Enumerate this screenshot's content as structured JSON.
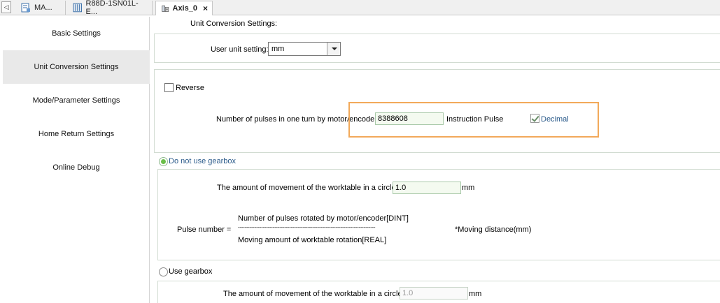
{
  "tabs": [
    {
      "label": "MA...",
      "icon": "program-icon"
    },
    {
      "label": "R88D-1SN01L-E...",
      "icon": "servo-drive-icon"
    },
    {
      "label": "Axis_0",
      "icon": "axis-icon",
      "active": true
    }
  ],
  "tab_close": "×",
  "tab_scroll": "◁",
  "sidebar": {
    "items": [
      {
        "label": "Basic Settings"
      },
      {
        "label": "Unit Conversion Settings",
        "active": true
      },
      {
        "label": "Mode/Parameter Settings"
      },
      {
        "label": "Home Return Settings"
      },
      {
        "label": "Online Debug"
      }
    ]
  },
  "main": {
    "section_title": "Unit Conversion Settings:",
    "user_unit": {
      "label": "User unit setting:",
      "value": "mm"
    },
    "reverse": {
      "label": "Reverse",
      "checked": false
    },
    "pulses": {
      "label": "Number of pulses in one turn by motor/encoder:",
      "value": "8388608",
      "unit": "Instruction Pulse",
      "decimal_label": "Decimal",
      "decimal_checked": true
    },
    "no_gearbox": {
      "label": "Do not use gearbox",
      "selected": true,
      "movement_label": "The amount of movement of the worktable in a circle:",
      "movement_value": "1.0",
      "movement_unit": "mm",
      "formula_prefix": "Pulse number =",
      "formula_numerator": "Number of pulses rotated by motor/encoder[DINT]",
      "formula_line": "-----------------------------------------------------------------------------------",
      "formula_denominator": "Moving amount of worktable rotation[REAL]",
      "formula_suffix": "*Moving distance(mm)"
    },
    "use_gearbox": {
      "label": "Use gearbox",
      "selected": false,
      "movement_label": "The amount of movement of the worktable in a circle:",
      "movement_value": "1.0",
      "movement_unit": "mm"
    }
  },
  "colors": {
    "highlight": "#f2a95a",
    "radio_on": "#6bbf4a",
    "link_blue": "#2a5a8a"
  }
}
